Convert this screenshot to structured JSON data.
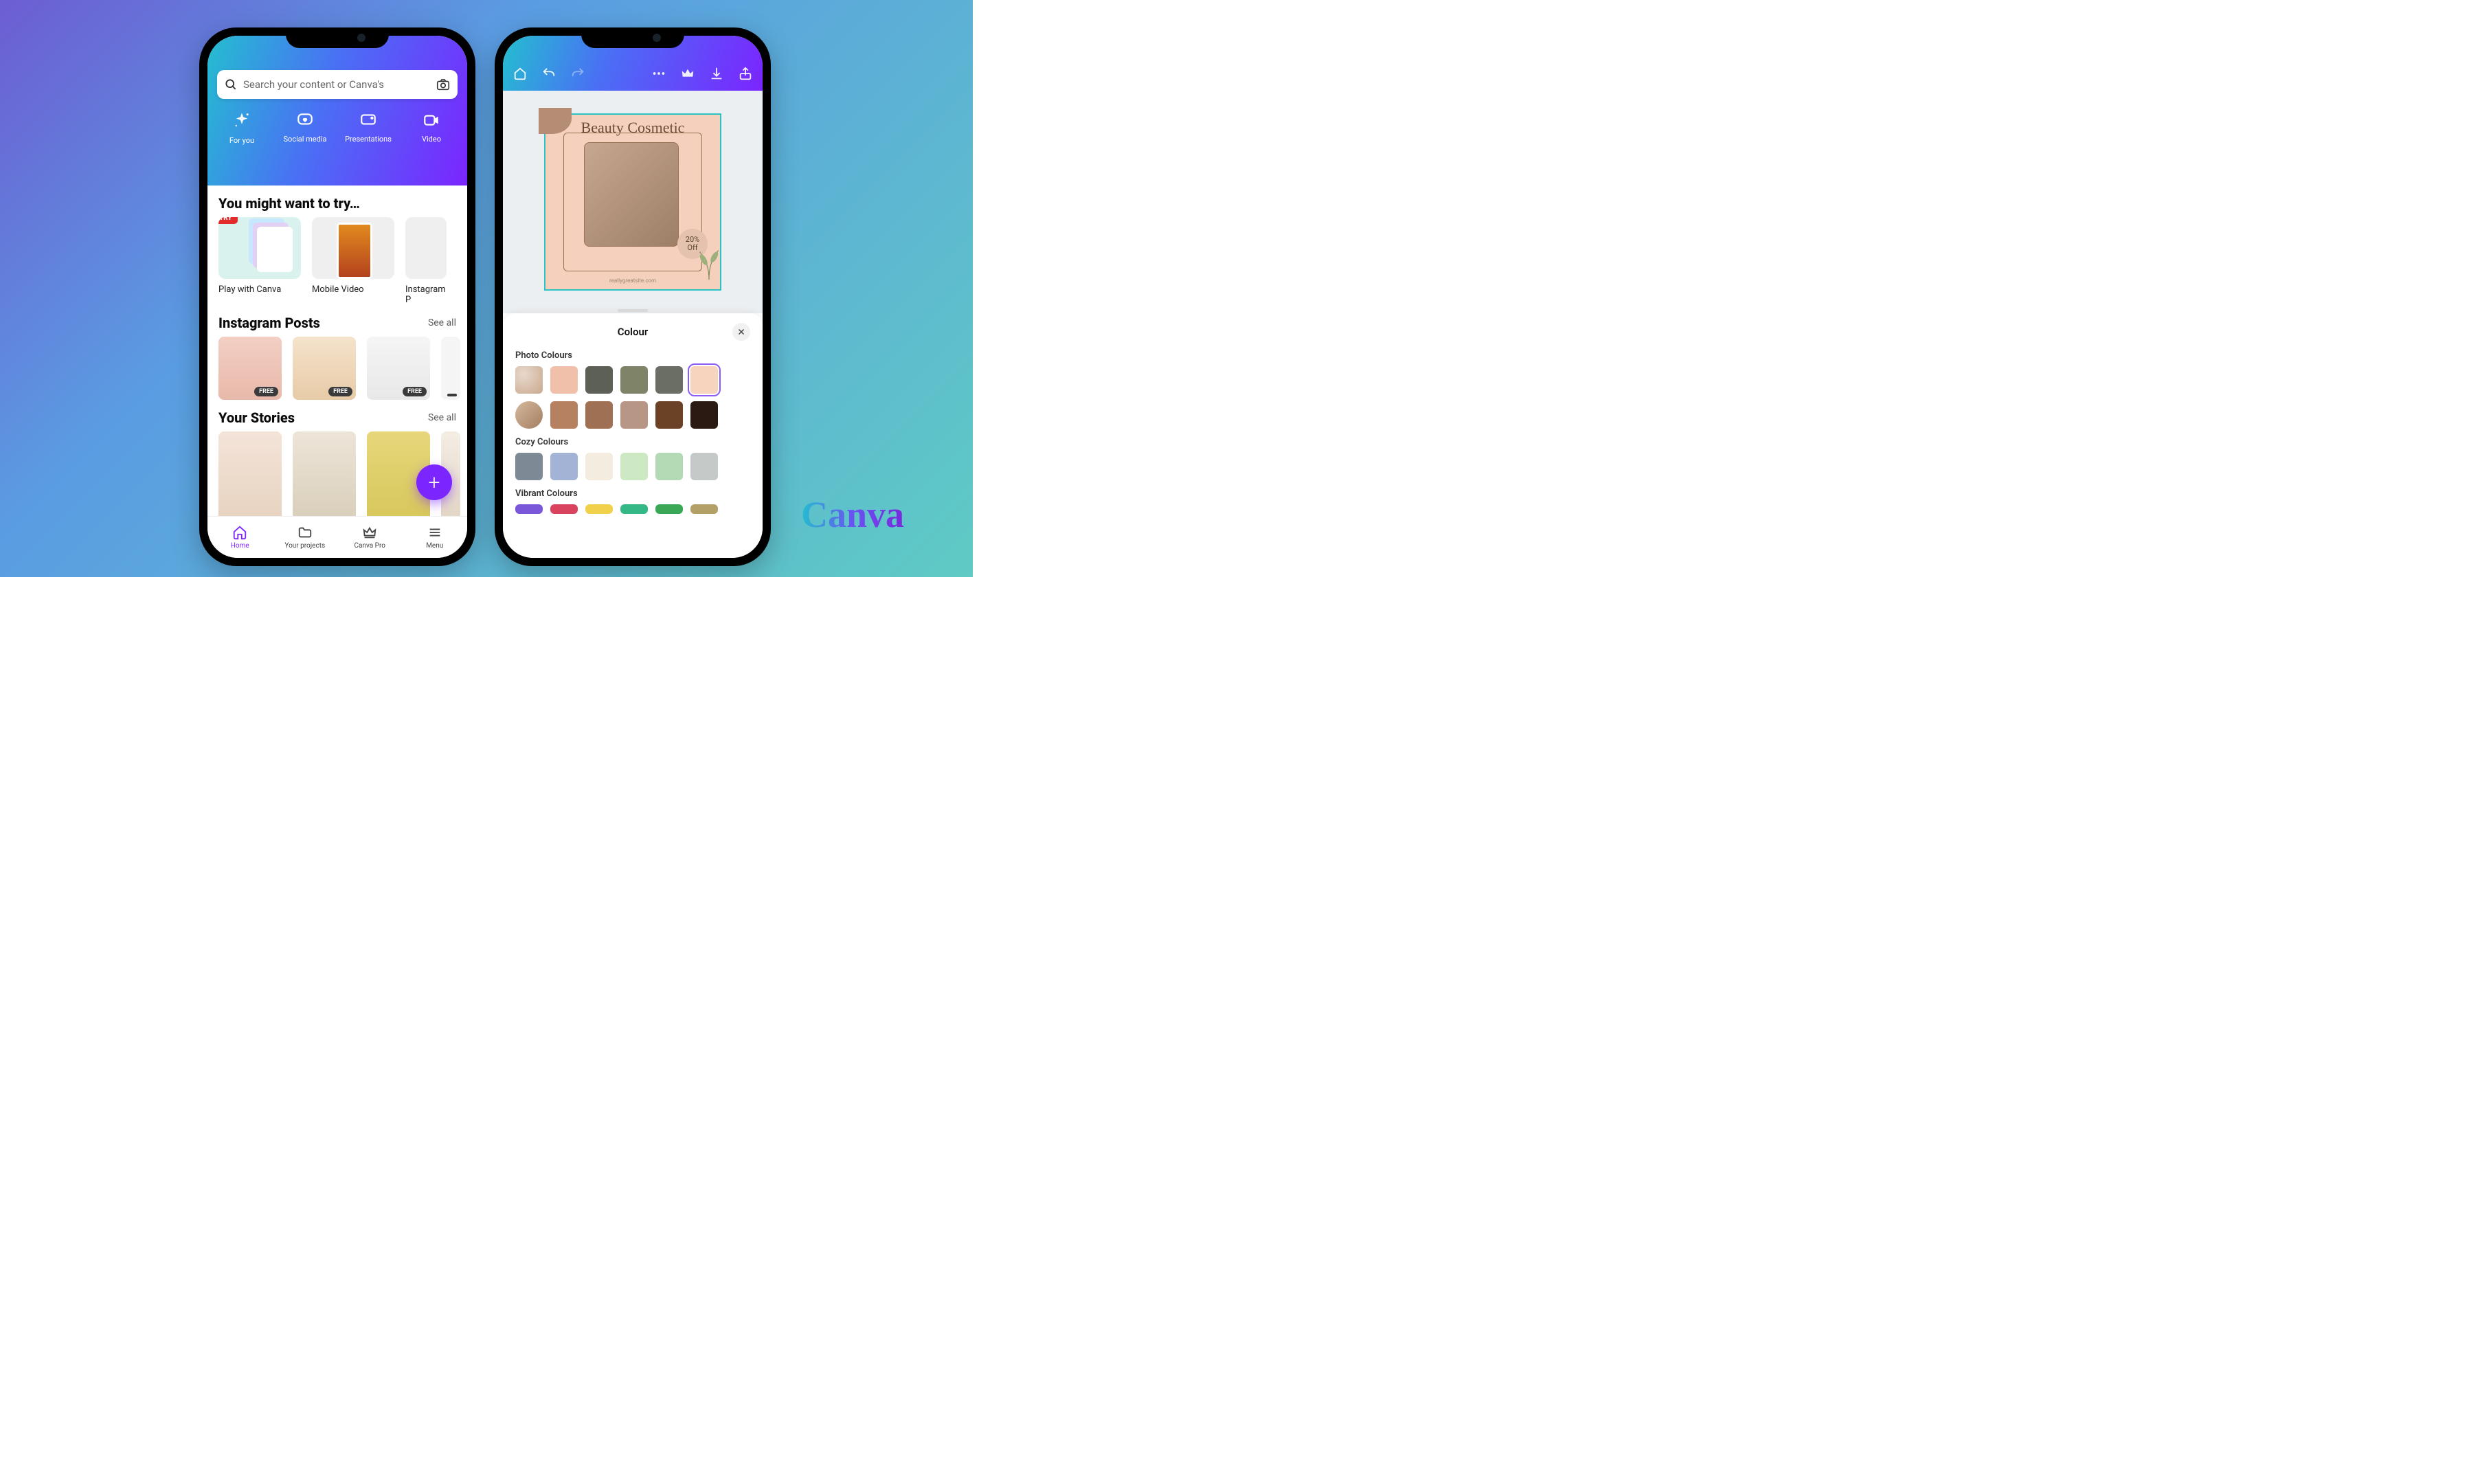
{
  "brand": "Canva",
  "home": {
    "search_placeholder": "Search your content or Canva's",
    "categories": [
      {
        "label": "For you"
      },
      {
        "label": "Social media"
      },
      {
        "label": "Presentations"
      },
      {
        "label": "Video"
      }
    ],
    "try_heading": "You might want to try…",
    "try_badge": "TRY",
    "try_items": [
      {
        "label": "Play with Canva"
      },
      {
        "label": "Mobile Video"
      },
      {
        "label": "Instagram P"
      }
    ],
    "ig_heading": "Instagram Posts",
    "ig_see_all": "See all",
    "ig_free_badge": "FREE",
    "stories_heading": "Your Stories",
    "stories_see_all": "See all",
    "nav": [
      {
        "label": "Home"
      },
      {
        "label": "Your projects"
      },
      {
        "label": "Canva Pro"
      },
      {
        "label": "Menu"
      }
    ]
  },
  "editor": {
    "design_title": "Beauty Cosmetic",
    "design_badge_top": "20%",
    "design_badge_bottom": "Off",
    "design_url": "reallygreatsite.com",
    "sheet_title": "Colour",
    "sections": {
      "photo": "Photo Colours",
      "cozy": "Cozy Colours",
      "vibrant": "Vibrant Colours"
    },
    "photo_row1": [
      "#f0c0ab",
      "#5d6057",
      "#7f8468",
      "#6a6e65",
      "#f6d4be"
    ],
    "photo_row2": [
      "#b58160",
      "#a07055",
      "#b79685",
      "#6c4226",
      "#2b1a12"
    ],
    "cozy_row": [
      "#7d8a96",
      "#a3b3d6",
      "#f3ecdf",
      "#cde9c4",
      "#b4d9b5",
      "#c5c9c7"
    ],
    "vibrant_row": [
      "#7a56d9",
      "#d9435e",
      "#f1d14b",
      "#34b885",
      "#3aa757",
      "#b3a067"
    ]
  }
}
